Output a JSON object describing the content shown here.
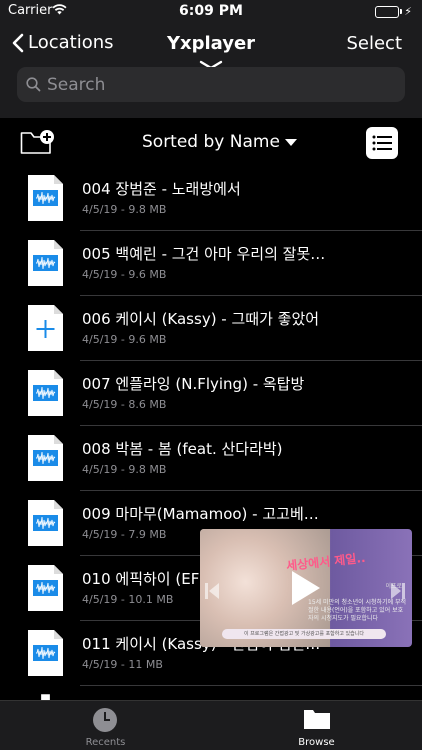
{
  "status_bar": {
    "carrier": "Carrier",
    "time": "6:09 PM",
    "battery_level": 0.9
  },
  "nav": {
    "back_label": "Locations",
    "title": "Yxplayer",
    "select_label": "Select"
  },
  "search": {
    "placeholder": "Search"
  },
  "toolbar": {
    "sort_label": "Sorted by Name"
  },
  "files": [
    {
      "name": "004 장범준 - 노래방에서",
      "meta": "4/5/19 - 9.8 MB",
      "icon": "audio-file-icon"
    },
    {
      "name": "005 백예린 - 그건 아마 우리의 잘못…",
      "meta": "4/5/19 - 9.6 MB",
      "icon": "audio-file-icon"
    },
    {
      "name": "006 케이시 (Kassy) - 그때가 좋았어",
      "meta": "4/5/19 - 9.6 MB",
      "icon": "plus-file-icon"
    },
    {
      "name": "007 엔플라잉 (N.Flying) - 옥탑방",
      "meta": "4/5/19 - 8.6 MB",
      "icon": "audio-file-icon"
    },
    {
      "name": "008 박봄 - 봄 (feat. 산다라박)",
      "meta": "4/5/19 - 9.8 MB",
      "icon": "audio-file-icon"
    },
    {
      "name": "009 마마무(Mamamoo) - 고고베…",
      "meta": "4/5/19 - 7.9 MB",
      "icon": "audio-file-icon"
    },
    {
      "name": "010 에픽하이 (EF",
      "meta": "4/5/19 - 10.1 MB",
      "icon": "audio-file-icon"
    },
    {
      "name": "011 케이시 (Kassy) - 산님이 님산…",
      "meta": "4/5/19 - 11 MB",
      "icon": "audio-file-icon"
    }
  ],
  "ad": {
    "headline": "세상에서 제일..",
    "text": "15세 미만의 청소년이 시청하기에 부적절한 내용(언어)을 포함하고 있어 보호자의 시청지도가 필요합니다",
    "footer": "이 프로그램은 간접광고 및 가상광고를 포함하고 있습니다",
    "brand": "이프로"
  },
  "tabs": {
    "recents_label": "Recents",
    "browse_label": "Browse"
  },
  "colors": {
    "accent": "#1a8be8",
    "background": "#000000",
    "bar": "#1c1c1e"
  }
}
